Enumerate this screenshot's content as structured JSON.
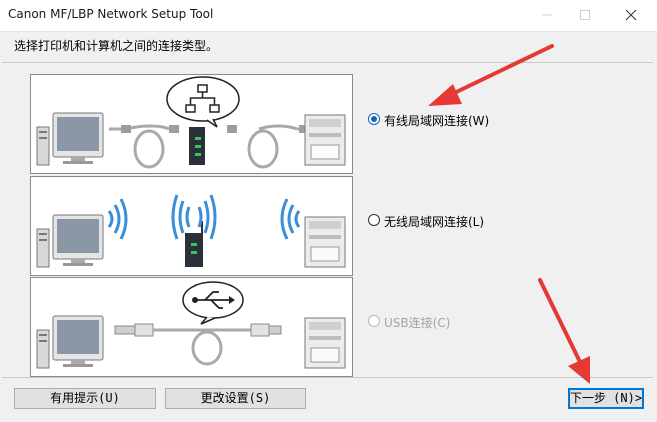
{
  "window": {
    "title": "Canon MF/LBP Network Setup Tool"
  },
  "instruction": "选择打印机和计算机之间的连接类型。",
  "options": [
    {
      "label": "有线局域网连接(W)",
      "selected": true,
      "disabled": false
    },
    {
      "label": "无线局域网连接(L)",
      "selected": false,
      "disabled": false
    },
    {
      "label": "USB连接(C)",
      "selected": false,
      "disabled": true
    }
  ],
  "buttons": {
    "hint": "有用提示(U)",
    "change_settings": "更改设置(S)",
    "next": "下一步 (N)>"
  },
  "colors": {
    "accent": "#1565c0",
    "annotation_arrow": "#e53935",
    "wireless_waves": "#3a8fd8"
  }
}
